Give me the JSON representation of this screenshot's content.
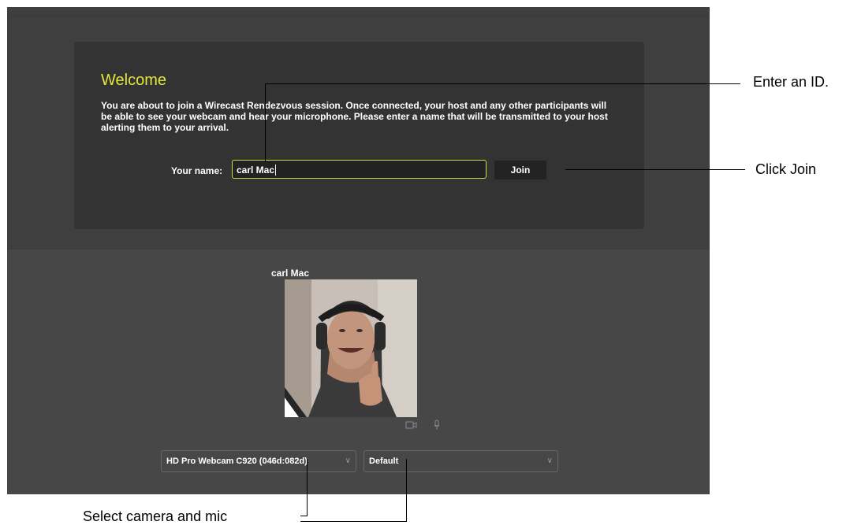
{
  "welcome": {
    "title": "Welcome",
    "body": "You are about to join a Wirecast Rendezvous session. Once connected, your host and any other participants will be able to see your webcam and hear your microphone. Please enter a name that will be transmitted to your host alerting them to your arrival."
  },
  "name_field": {
    "label": "Your name:",
    "value": "carl Mac"
  },
  "join_button": {
    "label": "Join"
  },
  "participant": {
    "name": "carl Mac"
  },
  "devices": {
    "camera": "HD Pro Webcam C920 (046d:082d)",
    "microphone": "Default"
  },
  "callouts": {
    "enter_id": "Enter an ID.",
    "click_join": "Click Join",
    "select_devices": "Select camera and mic"
  },
  "colors": {
    "accent_title": "#e2e83a",
    "input_border": "#d5d94a",
    "panel_background": "#333333",
    "app_background": "#474747"
  }
}
